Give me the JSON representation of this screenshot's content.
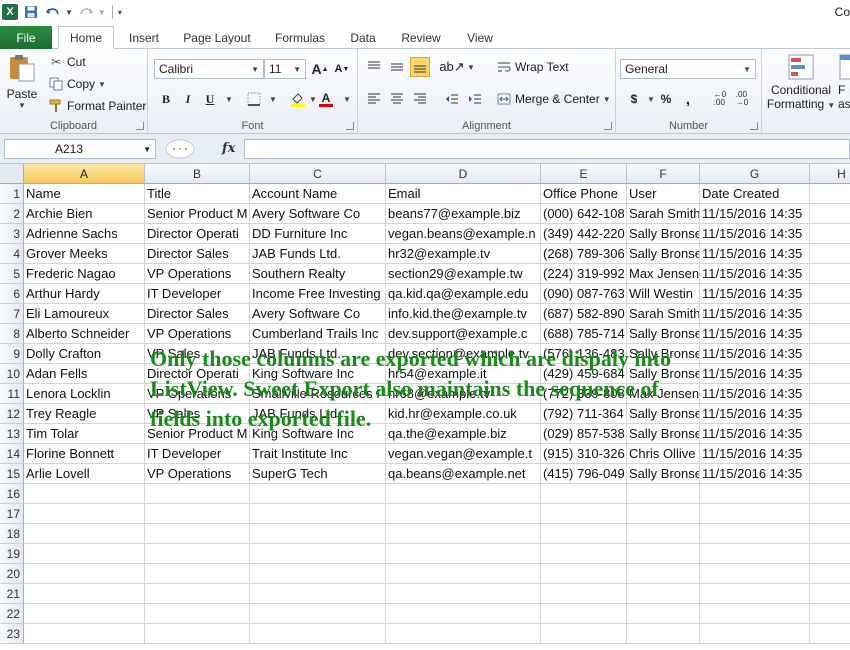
{
  "app": {
    "logo": "X",
    "title_partial": "Co"
  },
  "tabs": {
    "file": "File",
    "items": [
      "Home",
      "Insert",
      "Page Layout",
      "Formulas",
      "Data",
      "Review",
      "View"
    ]
  },
  "ribbon": {
    "clipboard": {
      "label": "Clipboard",
      "paste": "Paste",
      "cut": "Cut",
      "copy": "Copy",
      "format_painter": "Format Painter"
    },
    "font": {
      "label": "Font",
      "name": "Calibri",
      "size": "11",
      "bold": "B",
      "italic": "I",
      "underline": "U"
    },
    "alignment": {
      "label": "Alignment",
      "wrap_text": "Wrap Text",
      "merge_center": "Merge & Center"
    },
    "number": {
      "label": "Number",
      "format": "General",
      "currency": "$",
      "percent": "%",
      "comma": ","
    },
    "styles": {
      "conditional": "Conditional",
      "formatting": "Formatting",
      "format_as_partial": "F",
      "as_partial": "as"
    }
  },
  "formula_bar": {
    "name_box": "A213",
    "fx": "fx",
    "content": ""
  },
  "columns": [
    "A",
    "B",
    "C",
    "D",
    "E",
    "F",
    "G",
    "H"
  ],
  "selected_column": "A",
  "row_numbers": [
    "1",
    "2",
    "3",
    "4",
    "5",
    "6",
    "7",
    "8",
    "9",
    "10",
    "11",
    "12",
    "13",
    "14",
    "15",
    "16",
    "17",
    "18",
    "19",
    "20",
    "21",
    "22",
    "23"
  ],
  "sheet_rows": [
    [
      "Name",
      "Title",
      "Account Name",
      "Email",
      "Office Phone",
      "User",
      "Date Created"
    ],
    [
      "Archie Bien",
      "Senior Product M",
      "Avery Software Co",
      "beans77@example.biz",
      "(000) 642-108",
      "Sarah Smith",
      "11/15/2016 14:35"
    ],
    [
      "Adrienne Sachs",
      "Director Operati",
      "DD Furniture Inc",
      "vegan.beans@example.n",
      "(349) 442-220",
      "Sally Bronse",
      "11/15/2016 14:35"
    ],
    [
      "Grover Meeks",
      "Director Sales",
      "JAB Funds Ltd.",
      "hr32@example.tv",
      "(268) 789-306",
      "Sally Bronse",
      "11/15/2016 14:35"
    ],
    [
      "Frederic Nagao",
      "VP Operations",
      "Southern Realty",
      "section29@example.tw",
      "(224) 319-992",
      "Max Jensen",
      "11/15/2016 14:35"
    ],
    [
      "Arthur Hardy",
      "IT Developer",
      "Income Free Investing",
      "qa.kid.qa@example.edu",
      "(090) 087-763",
      "Will Westin",
      "11/15/2016 14:35"
    ],
    [
      "Eli Lamoureux",
      "Director Sales",
      "Avery Software Co",
      "info.kid.the@example.tv",
      "(687) 582-890",
      "Sarah Smith",
      "11/15/2016 14:35"
    ],
    [
      "Alberto Schneider",
      "VP Operations",
      "Cumberland Trails Inc",
      "dev.support@example.c",
      "(688) 785-714",
      "Sally Bronse",
      "11/15/2016 14:35"
    ],
    [
      "Dolly Crafton",
      "VP Sales",
      "JAB Funds Ltd.",
      "dev.section@example.tv",
      "(576) 136-483",
      "Sally Bronse",
      "11/15/2016 14:35"
    ],
    [
      "Adan Fells",
      "Director Operati",
      "King Software Inc",
      "hr54@example.it",
      "(429) 459-684",
      "Sally Bronse",
      "11/15/2016 14:35"
    ],
    [
      "Lenora Locklin",
      "VP Operations",
      "Smallville Resources I",
      "hr68@example.tv",
      "(772) 339-808",
      "Max Jensen",
      "11/15/2016 14:35"
    ],
    [
      "Trey Reagle",
      "VP Sales",
      "JAB Funds Ltd.",
      "kid.hr@example.co.uk",
      "(792) 711-364",
      "Sally Bronse",
      "11/15/2016 14:35"
    ],
    [
      "Tim Tolar",
      "Senior Product M",
      "King Software Inc",
      "qa.the@example.biz",
      "(029) 857-538",
      "Sally Bronse",
      "11/15/2016 14:35"
    ],
    [
      "Florine Bonnett",
      "IT Developer",
      "Trait Institute Inc",
      "vegan.vegan@example.t",
      "(915) 310-326",
      "Chris Ollive",
      "11/15/2016 14:35"
    ],
    [
      "Arlie Lovell",
      "VP Operations",
      "SuperG Tech",
      "qa.beans@example.net",
      "(415) 796-049",
      "Sally Bronse",
      "11/15/2016 14:35"
    ]
  ],
  "annotation": "Only those columns are exported which are dispaly into ListView. Sweet Export also maintains the sequence of fields into exported file.",
  "colors": {
    "file_tab": "#1e7e34",
    "annotation": "#1a8a1a",
    "selected_header": "#f3c85b"
  }
}
